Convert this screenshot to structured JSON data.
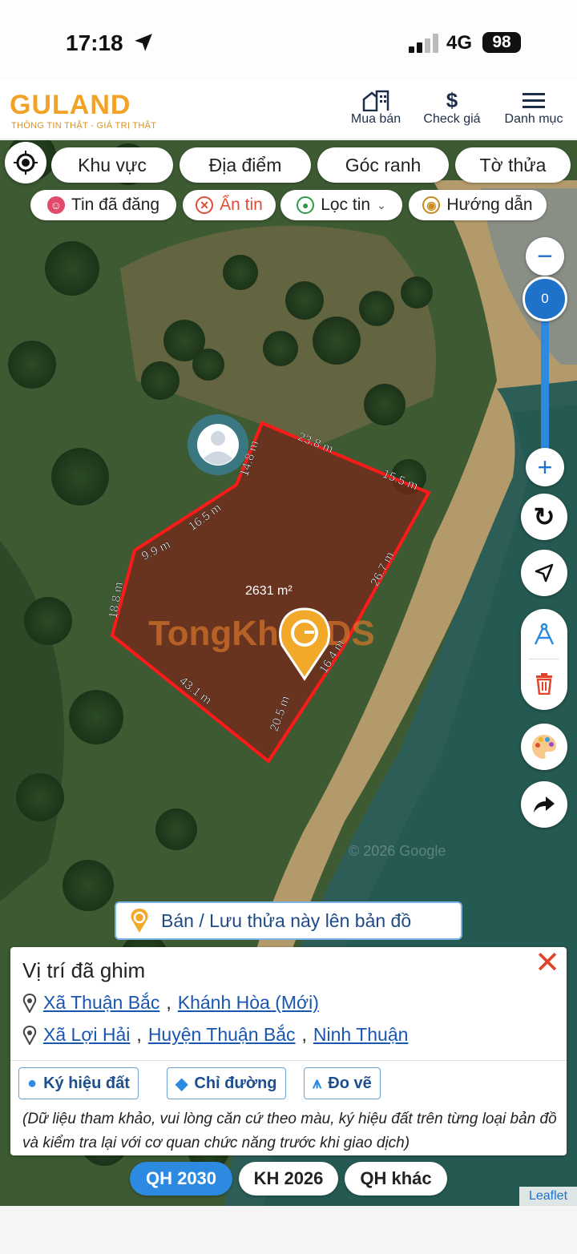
{
  "status_bar": {
    "time": "17:18",
    "network": "4G",
    "battery": "98"
  },
  "header": {
    "logo": "GULAND",
    "tagline": "THÔNG TIN THẬT - GIÁ TRỊ THẬT",
    "nav": [
      {
        "label": "Mua bán",
        "icon": "building-icon"
      },
      {
        "label": "Check giá",
        "icon": "dollar-icon"
      },
      {
        "label": "Danh mục",
        "icon": "menu-icon"
      }
    ]
  },
  "map": {
    "tabs": [
      "Khu vực",
      "Địa điểm",
      "Góc ranh",
      "Tờ thửa"
    ],
    "chips": [
      "Tin đã đăng",
      "Ẩn tin",
      "Lọc tin",
      "Hướng dẫn"
    ],
    "zoom_level": "0",
    "zoom_in": "+",
    "zoom_out": "−",
    "parcel": {
      "area": "2631 m²",
      "edges": [
        "23.8 m",
        "15.5 m",
        "26.7 m",
        "16.4 m",
        "20.5 m",
        "43.1 m",
        "18.8 m",
        "9.9 m",
        "16.5 m",
        "14.8 m"
      ]
    },
    "watermark": "TongKhoBDS",
    "google_credit": "© 2026 Google",
    "save_label": "Bán / Lưu thửa này lên bản đồ",
    "leaflet": "Leaflet",
    "colors": {
      "parcel_outline": "#ff1a1a",
      "accent": "#1f72c9",
      "brand": "#f2a227"
    }
  },
  "panel": {
    "title": "Vị trí đã ghim",
    "location_1": {
      "commune": "Xã Thuận Bắc",
      "province": "Khánh Hòa (Mới)"
    },
    "location_2": {
      "commune": "Xã Lợi Hải",
      "district": "Huyện Thuận Bắc",
      "province": "Ninh Thuận"
    },
    "actions": [
      "Ký hiệu đất",
      "Chỉ đường",
      "Đo vẽ"
    ],
    "note": "(Dữ liệu tham khảo, vui lòng căn cứ theo màu, ký hiệu đất trên từng loại bản đồ và kiểm tra lại với cơ quan chức năng trước khi giao dịch)"
  },
  "plan_tabs": [
    {
      "label": "QH 2030",
      "active": true
    },
    {
      "label": "KH 2026",
      "active": false
    },
    {
      "label": "QH khác",
      "active": false
    }
  ]
}
